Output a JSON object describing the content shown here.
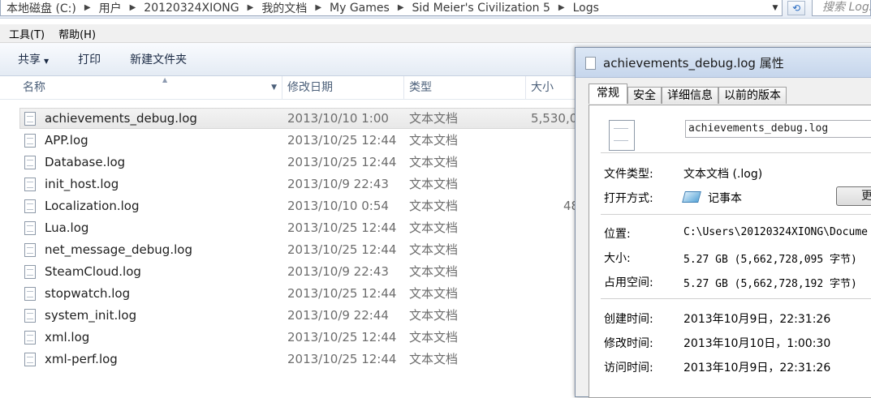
{
  "address": {
    "crumbs": [
      "本地磁盘 (C:)",
      "用户",
      "20120324XIONG",
      "我的文档",
      "My Games",
      "Sid Meier's Civilization 5",
      "Logs"
    ],
    "search_placeholder": "搜索 Logs"
  },
  "menu": [
    "工具(T)",
    "帮助(H)"
  ],
  "toolbar": {
    "share": "共享",
    "print": "打印",
    "new_folder": "新建文件夹"
  },
  "columns": {
    "name": "名称",
    "date": "修改日期",
    "type": "类型",
    "size": "大小"
  },
  "files": [
    {
      "name": "achievements_debug.log",
      "date": "2013/10/10 1:00",
      "type": "文本文档",
      "size": "5,530,0"
    },
    {
      "name": "APP.log",
      "date": "2013/10/25 12:44",
      "type": "文本文档",
      "size": ""
    },
    {
      "name": "Database.log",
      "date": "2013/10/25 12:44",
      "type": "文本文档",
      "size": ""
    },
    {
      "name": "init_host.log",
      "date": "2013/10/9 22:43",
      "type": "文本文档",
      "size": ""
    },
    {
      "name": "Localization.log",
      "date": "2013/10/10 0:54",
      "type": "文本文档",
      "size": "48"
    },
    {
      "name": "Lua.log",
      "date": "2013/10/25 12:44",
      "type": "文本文档",
      "size": ""
    },
    {
      "name": "net_message_debug.log",
      "date": "2013/10/25 12:44",
      "type": "文本文档",
      "size": ""
    },
    {
      "name": "SteamCloud.log",
      "date": "2013/10/9 22:43",
      "type": "文本文档",
      "size": ""
    },
    {
      "name": "stopwatch.log",
      "date": "2013/10/25 12:44",
      "type": "文本文档",
      "size": ""
    },
    {
      "name": "system_init.log",
      "date": "2013/10/9 22:44",
      "type": "文本文档",
      "size": ""
    },
    {
      "name": "xml.log",
      "date": "2013/10/25 12:44",
      "type": "文本文档",
      "size": ""
    },
    {
      "name": "xml-perf.log",
      "date": "2013/10/25 12:44",
      "type": "文本文档",
      "size": ""
    }
  ],
  "dialog": {
    "title": "achievements_debug.log 属性",
    "tabs": [
      "常规",
      "安全",
      "详细信息",
      "以前的版本"
    ],
    "filename": "achievements_debug.log",
    "file_type_label": "文件类型:",
    "file_type_value": "文本文档 (.log)",
    "open_with_label": "打开方式:",
    "open_with_value": "记事本",
    "change_button": "更",
    "location_label": "位置:",
    "location_value": "C:\\Users\\20120324XIONG\\Docume",
    "size_label": "大小:",
    "size_value": "5.27 GB (5,662,728,095 字节)",
    "disk_size_label": "占用空间:",
    "disk_size_value": "5.27 GB (5,662,728,192 字节)",
    "created_label": "创建时间:",
    "created_value": "2013年10月9日，22:31:26",
    "modified_label": "修改时间:",
    "modified_value": "2013年10月10日，1:00:30",
    "accessed_label": "访问时间:",
    "accessed_value": "2013年10月9日，22:31:26"
  },
  "colors": {
    "accent": "#2a6cc2",
    "selection": "#e8e8e8"
  }
}
